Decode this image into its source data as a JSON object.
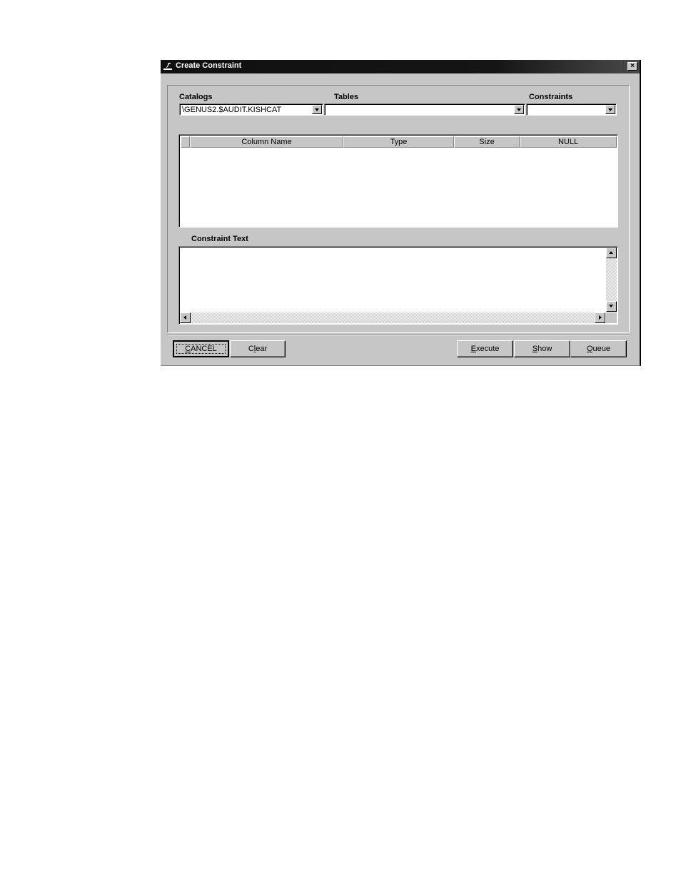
{
  "window": {
    "title": "Create Constraint",
    "icon": "app-logo-icon",
    "close_label": "×"
  },
  "fields": {
    "catalogs": {
      "label": "Catalogs",
      "value": "\\GENUS2.$AUDIT.KISHCAT"
    },
    "tables": {
      "label": "Tables",
      "value": ""
    },
    "constraints": {
      "label": "Constraints",
      "value": ""
    }
  },
  "table": {
    "columns": [
      "Column Name",
      "Type",
      "Size",
      "NULL"
    ],
    "rows": []
  },
  "constraint_text": {
    "label": "Constraint Text",
    "value": ""
  },
  "buttons": {
    "cancel": {
      "label": "CANCEL",
      "mnemonic": "C",
      "rest": "ANCEL"
    },
    "clear": {
      "label": "Clear",
      "mnemonic": "l",
      "before": "C",
      "after": "ear"
    },
    "execute": {
      "label": "Execute",
      "mnemonic": "E",
      "rest": "xecute"
    },
    "show": {
      "label": "Show",
      "mnemonic": "S",
      "rest": "how"
    },
    "queue": {
      "label": "Queue",
      "mnemonic": "Q",
      "rest": "ueue"
    }
  }
}
